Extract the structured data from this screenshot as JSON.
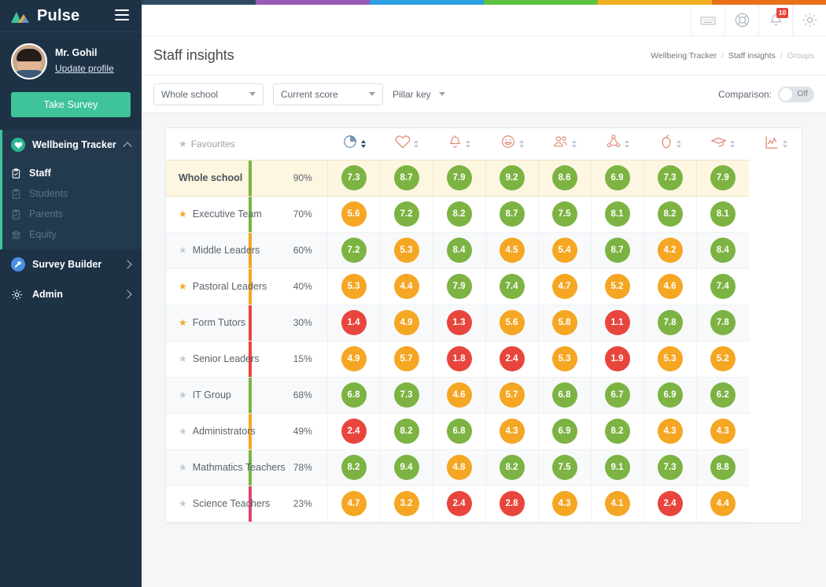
{
  "brand": {
    "name": "Pulse",
    "logo_icon": "mountain-logo-icon",
    "menu_icon": "hamburger-menu-icon"
  },
  "profile": {
    "name": "Mr. Gohil",
    "update_link": "Update profile",
    "avatar_icon": "user-avatar"
  },
  "sidebar": {
    "survey_button": "Take Survey",
    "groups": [
      {
        "label": "Wellbeing Tracker",
        "icon": "heart-badge-icon",
        "expanded": true,
        "items": [
          {
            "label": "Staff",
            "icon": "clipboard-check-icon",
            "enabled": true
          },
          {
            "label": "Students",
            "icon": "clipboard-check-icon",
            "enabled": false
          },
          {
            "label": "Parents",
            "icon": "clipboard-check-icon",
            "enabled": false
          },
          {
            "label": "Equity",
            "icon": "bank-icon",
            "enabled": false
          }
        ]
      },
      {
        "label": "Survey Builder",
        "icon": "wrench-badge-icon",
        "expanded": false
      },
      {
        "label": "Admin",
        "icon": "gear-icon",
        "expanded": false
      }
    ]
  },
  "topbar": {
    "icons": [
      {
        "name": "keyboard-icon",
        "badge": null
      },
      {
        "name": "lifebuoy-help-icon",
        "badge": null
      },
      {
        "name": "bell-notification-icon",
        "badge": "10"
      },
      {
        "name": "settings-gear-icon",
        "badge": null
      }
    ]
  },
  "accent_colors": [
    "#2f4a60",
    "#9b59b6",
    "#2e9fe0",
    "#5ec23f",
    "#f2b01e",
    "#e8701a"
  ],
  "page": {
    "title": "Staff insights",
    "breadcrumb": [
      {
        "label": "Wellbeing Tracker",
        "current": false
      },
      {
        "label": "Staff insights",
        "current": false
      },
      {
        "label": "Groups",
        "current": true
      }
    ]
  },
  "filters": {
    "scope_select": {
      "value": "Whole school",
      "options": [
        "Whole school"
      ]
    },
    "score_select": {
      "value": "Current score",
      "options": [
        "Current score"
      ]
    },
    "pillar_key": "Pillar key",
    "comparison_label": "Comparison:",
    "comparison_state": "Off"
  },
  "table": {
    "favourites_header": "Favourites",
    "columns": [
      {
        "icon": "pie-chart-icon",
        "sort_active": true
      },
      {
        "icon": "heart-icon",
        "sort_active": false
      },
      {
        "icon": "bell-icon",
        "sort_active": false
      },
      {
        "icon": "smiley-face-icon",
        "sort_active": false
      },
      {
        "icon": "people-group-icon",
        "sort_active": false
      },
      {
        "icon": "network-nodes-icon",
        "sort_active": false
      },
      {
        "icon": "apple-icon",
        "sort_active": false
      },
      {
        "icon": "graduation-cap-icon",
        "sort_active": false
      },
      {
        "icon": "line-chart-icon",
        "sort_active": false
      }
    ],
    "rows": [
      {
        "name": "Whole school",
        "is_total": true,
        "favourite": null,
        "percent": "90%",
        "bar_color": "#7cb342",
        "scores": [
          "7.3",
          "8.7",
          "7.9",
          "9.2",
          "8.6",
          "6.9",
          "7.3",
          "7.9"
        ]
      },
      {
        "name": "Executive Team",
        "is_total": false,
        "favourite": true,
        "percent": "70%",
        "bar_color": "#7cb342",
        "scores": [
          "5.6",
          "7.2",
          "8.2",
          "8.7",
          "7.5",
          "8.1",
          "8.2",
          "8.1"
        ]
      },
      {
        "name": "Middle Leaders",
        "is_total": false,
        "favourite": false,
        "percent": "60%",
        "bar_color": "#f5a623",
        "scores": [
          "7.2",
          "5.3",
          "8.4",
          "4.5",
          "5.4",
          "8.7",
          "4.2",
          "8.4"
        ]
      },
      {
        "name": "Pastoral Leaders",
        "is_total": false,
        "favourite": true,
        "percent": "40%",
        "bar_color": "#f5a623",
        "scores": [
          "5.3",
          "4.4",
          "7.9",
          "7.4",
          "4.7",
          "5.2",
          "4.6",
          "7.4"
        ]
      },
      {
        "name": "Form Tutors",
        "is_total": false,
        "favourite": true,
        "percent": "30%",
        "bar_color": "#e8453c",
        "scores": [
          "1.4",
          "4.9",
          "1.3",
          "5.6",
          "5.8",
          "1.1",
          "7.8",
          "7.8"
        ]
      },
      {
        "name": "Senior Leaders",
        "is_total": false,
        "favourite": false,
        "percent": "15%",
        "bar_color": "#e8453c",
        "scores": [
          "4.9",
          "5.7",
          "1.8",
          "2.4",
          "5.3",
          "1.9",
          "5.3",
          "5.2"
        ]
      },
      {
        "name": "IT Group",
        "is_total": false,
        "favourite": false,
        "percent": "68%",
        "bar_color": "#7cb342",
        "scores": [
          "6.8",
          "7.3",
          "4.6",
          "5.7",
          "6.8",
          "6.7",
          "6.9",
          "6.2"
        ]
      },
      {
        "name": "Administrators",
        "is_total": false,
        "favourite": false,
        "percent": "49%",
        "bar_color": "#f5a623",
        "scores": [
          "2.4",
          "8.2",
          "6.8",
          "4.3",
          "6.9",
          "8.2",
          "4.3",
          "4.3"
        ]
      },
      {
        "name": "Mathmatics Teachers",
        "is_total": false,
        "favourite": false,
        "percent": "78%",
        "bar_color": "#7cb342",
        "scores": [
          "8.2",
          "9.4",
          "4.8",
          "8.2",
          "7.5",
          "9.1",
          "7.3",
          "8.8"
        ]
      },
      {
        "name": "Science Teachers",
        "is_total": false,
        "favourite": false,
        "percent": "23%",
        "bar_color": "#e0456b",
        "scores": [
          "4.7",
          "3.2",
          "2.4",
          "2.8",
          "4.3",
          "4.1",
          "2.4",
          "4.4"
        ]
      }
    ],
    "score_colors": {
      "high": "#7cb342",
      "mid": "#f5a623",
      "low": "#e8453c"
    },
    "score_thresholds": {
      "high_min": 6.0,
      "mid_min": 3.0
    }
  }
}
